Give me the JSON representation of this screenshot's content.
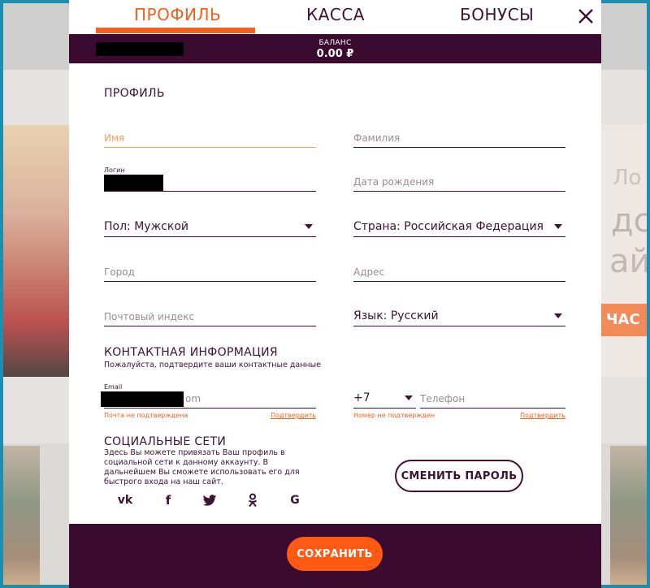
{
  "tabs": [
    {
      "label": "ПРОФИЛЬ",
      "active": true
    },
    {
      "label": "КАССА",
      "active": false
    },
    {
      "label": "БОНУСЫ",
      "active": false
    }
  ],
  "balance": {
    "label": "БАЛАНС",
    "value": "0.00 ₽"
  },
  "profile": {
    "title": "ПРОФИЛЬ",
    "first_name_placeholder": "Имя",
    "last_name_placeholder": "Фамилия",
    "login_label": "Логин",
    "birthdate_placeholder": "Дата рождения",
    "gender_value": "Пол: Мужской",
    "country_value": "Страна: Российская Федерация",
    "city_placeholder": "Город",
    "address_placeholder": "Адрес",
    "postal_placeholder": "Почтовый индекс",
    "language_value": "Язык: Русский"
  },
  "contact": {
    "title": "КОНТАКТНАЯ ИНФОРМАЦИЯ",
    "subtitle": "Пожалуйста, подтвердите ваши контактные данные",
    "email_label": "Email",
    "email_visible_suffix": "om",
    "email_status": "Почта не подтверждена",
    "email_verify": "Подтвердить",
    "phone_code": "+7",
    "phone_placeholder": "Телефон",
    "phone_status": "Номер не подтвержден",
    "phone_verify": "Подтвердить"
  },
  "social": {
    "title": "СОЦИАЛЬНЫЕ СЕТИ",
    "description": "Здесь Вы можете привязать Ваш профиль в социальной сети к данному аккаунту. В дальнейшем Вы сможете использовать его для быстрого входа на наш сайт.",
    "icons": [
      "vk-icon",
      "facebook-icon",
      "twitter-icon",
      "odnoklassniki-icon",
      "google-icon"
    ]
  },
  "buttons": {
    "change_password": "СМЕНИТЬ ПАРОЛЬ",
    "save": "СОХРАНИТЬ"
  },
  "colors": {
    "accent": "#f6601e",
    "brand_dark": "#3b0a2f"
  }
}
